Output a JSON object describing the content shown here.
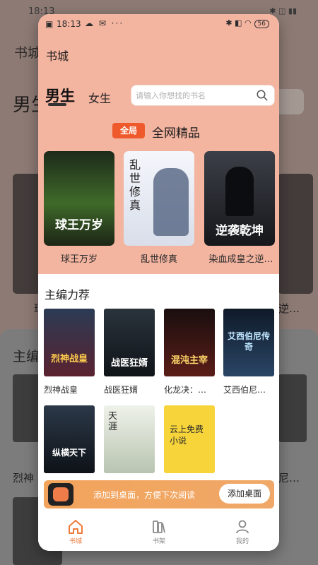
{
  "background": {
    "status_time": "18:13",
    "title": "书城",
    "male_tab": "男生",
    "editor_title": "主编",
    "row_labels": [
      "球",
      "烈神"
    ],
    "right_labels": [
      "逆…",
      "尼…"
    ]
  },
  "status_bar": {
    "time": "18:13",
    "battery": "56"
  },
  "app": {
    "title": "书城"
  },
  "tabs": {
    "male": "男生",
    "female": "女生"
  },
  "search": {
    "placeholder": "请输入你想找的书名"
  },
  "featured": {
    "badge": "全局",
    "title": "全网精品",
    "books": [
      {
        "title": "球王万岁",
        "cover_text": "球王万岁",
        "cover_color": "#2f4a1f"
      },
      {
        "title": "乱世修真",
        "cover_text": "乱世修真",
        "cover_color": "#e9ecf3"
      },
      {
        "title": "染血成皇之逆…",
        "cover_text": "逆袭乾坤",
        "cover_color": "#2b2b2b"
      }
    ]
  },
  "editor_picks": {
    "title": "主编力荐",
    "books": [
      {
        "title": "烈神战皇",
        "cover_text": "烈神战皇",
        "cover_color": "#3a2230"
      },
      {
        "title": "战医狂婿",
        "cover_text": "战医狂婿",
        "cover_color": "#1f2a33"
      },
      {
        "title": "化龙决：…",
        "cover_text": "混沌主宰",
        "cover_color": "#2c1716"
      },
      {
        "title": "艾西伯尼…",
        "cover_text": "艾西伯尼传奇",
        "cover_color": "#16222f"
      },
      {
        "title": "",
        "cover_text": "纵横天下",
        "cover_color": "#1b2430"
      },
      {
        "title": "",
        "cover_text": "天涯",
        "cover_color": "#d9e1d2"
      },
      {
        "title": "",
        "cover_text": "云上免费小说",
        "cover_color": "#f7d53a"
      }
    ]
  },
  "add_to_desktop": {
    "message": "添加到桌面，方便下次阅读",
    "button": "添加桌面"
  },
  "bottom_nav": {
    "items": [
      {
        "label": "书城",
        "icon": "home-icon",
        "active": true
      },
      {
        "label": "书架",
        "icon": "bookshelf-icon",
        "active": false
      },
      {
        "label": "我的",
        "icon": "profile-icon",
        "active": false
      }
    ]
  },
  "colors": {
    "accent": "#ef7a3a",
    "hero_bg": "#f3b4a0",
    "badge": "#ef5a2c"
  }
}
